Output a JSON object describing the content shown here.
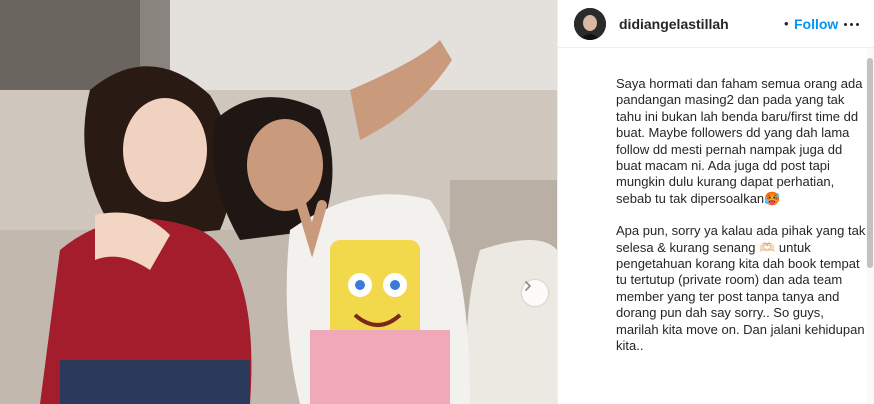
{
  "post": {
    "username": "didiangelastillah",
    "separator": "•",
    "follow_label": "Follow",
    "caption_paragraphs": [
      "Saya hormati dan faham semua orang ada pandangan masing2 dan pada yang tak tahu ini bukan lah benda baru/first time dd buat. Maybe followers dd yang dah lama follow dd mesti pernah nampak juga dd buat macam ni. Ada juga dd post tapi mungkin dulu kurang dapat perhatian, sebab tu tak dipersoalkan🥵",
      "Apa pun, sorry ya kalau ada pihak yang tak selesa & kurang senang 🫶🏻 untuk pengetahuan korang kita dah book tempat tu tertutup (private room) dan ada team member yang ter post tanpa tanya and dorang pun dah say sorry.. So guys, marilah kita move on. Dan jalani kehidupan kita.."
    ]
  },
  "icons": {
    "avatar": "profile-avatar",
    "more": "more-options-icon",
    "carousel_next": "chevron-right-icon"
  },
  "colors": {
    "follow": "#0095f6",
    "text": "#262626",
    "divider": "#efefef"
  }
}
